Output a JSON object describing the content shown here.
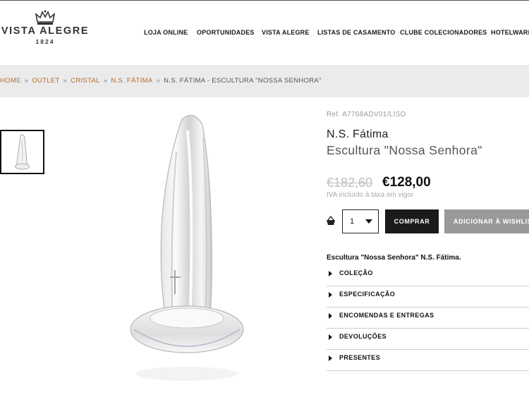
{
  "header": {
    "brand": "VISTA ALEGRE",
    "year": "1824",
    "nav": [
      "LOJA ONLINE",
      "OPORTUNIDADES",
      "VISTA ALEGRE",
      "LISTAS DE CASAMENTO",
      "CLUBE COLECIONADORES",
      "HOTELWARE"
    ]
  },
  "breadcrumb": {
    "items": [
      "HOME",
      "OUTLET",
      "CRISTAL",
      "N.S. FÁTIMA"
    ],
    "separator": "»",
    "current": "N.S. FÁTIMA - ESCULTURA \"NOSSA SENHORA\""
  },
  "product": {
    "ref": "Ref. A7768ADV01/LISO",
    "title": "N.S. Fátima",
    "subtitle": "Escultura \"Nossa Senhora\"",
    "old_price": "€182,60",
    "price": "€128,00",
    "vat_note": "IVA incluído à taxa em vigor",
    "quantity": "1",
    "buy_label": "COMPRAR",
    "wishlist_label": "ADICIONAR À WISHLIST",
    "description": "Escultura \"Nossa Senhora\" N.S. Fátima."
  },
  "accordion": [
    "COLEÇÃO",
    "ESPECIFICAÇÃO",
    "ENCOMENDAS E ENTREGAS",
    "DEVOLUÇÕES",
    "PRESENTES"
  ],
  "colors": {
    "accent": "#b36b2c",
    "breadcrumb_bg": "#ebebeb",
    "buy_button": "#1a1a1a",
    "wishlist_button": "#999999"
  }
}
